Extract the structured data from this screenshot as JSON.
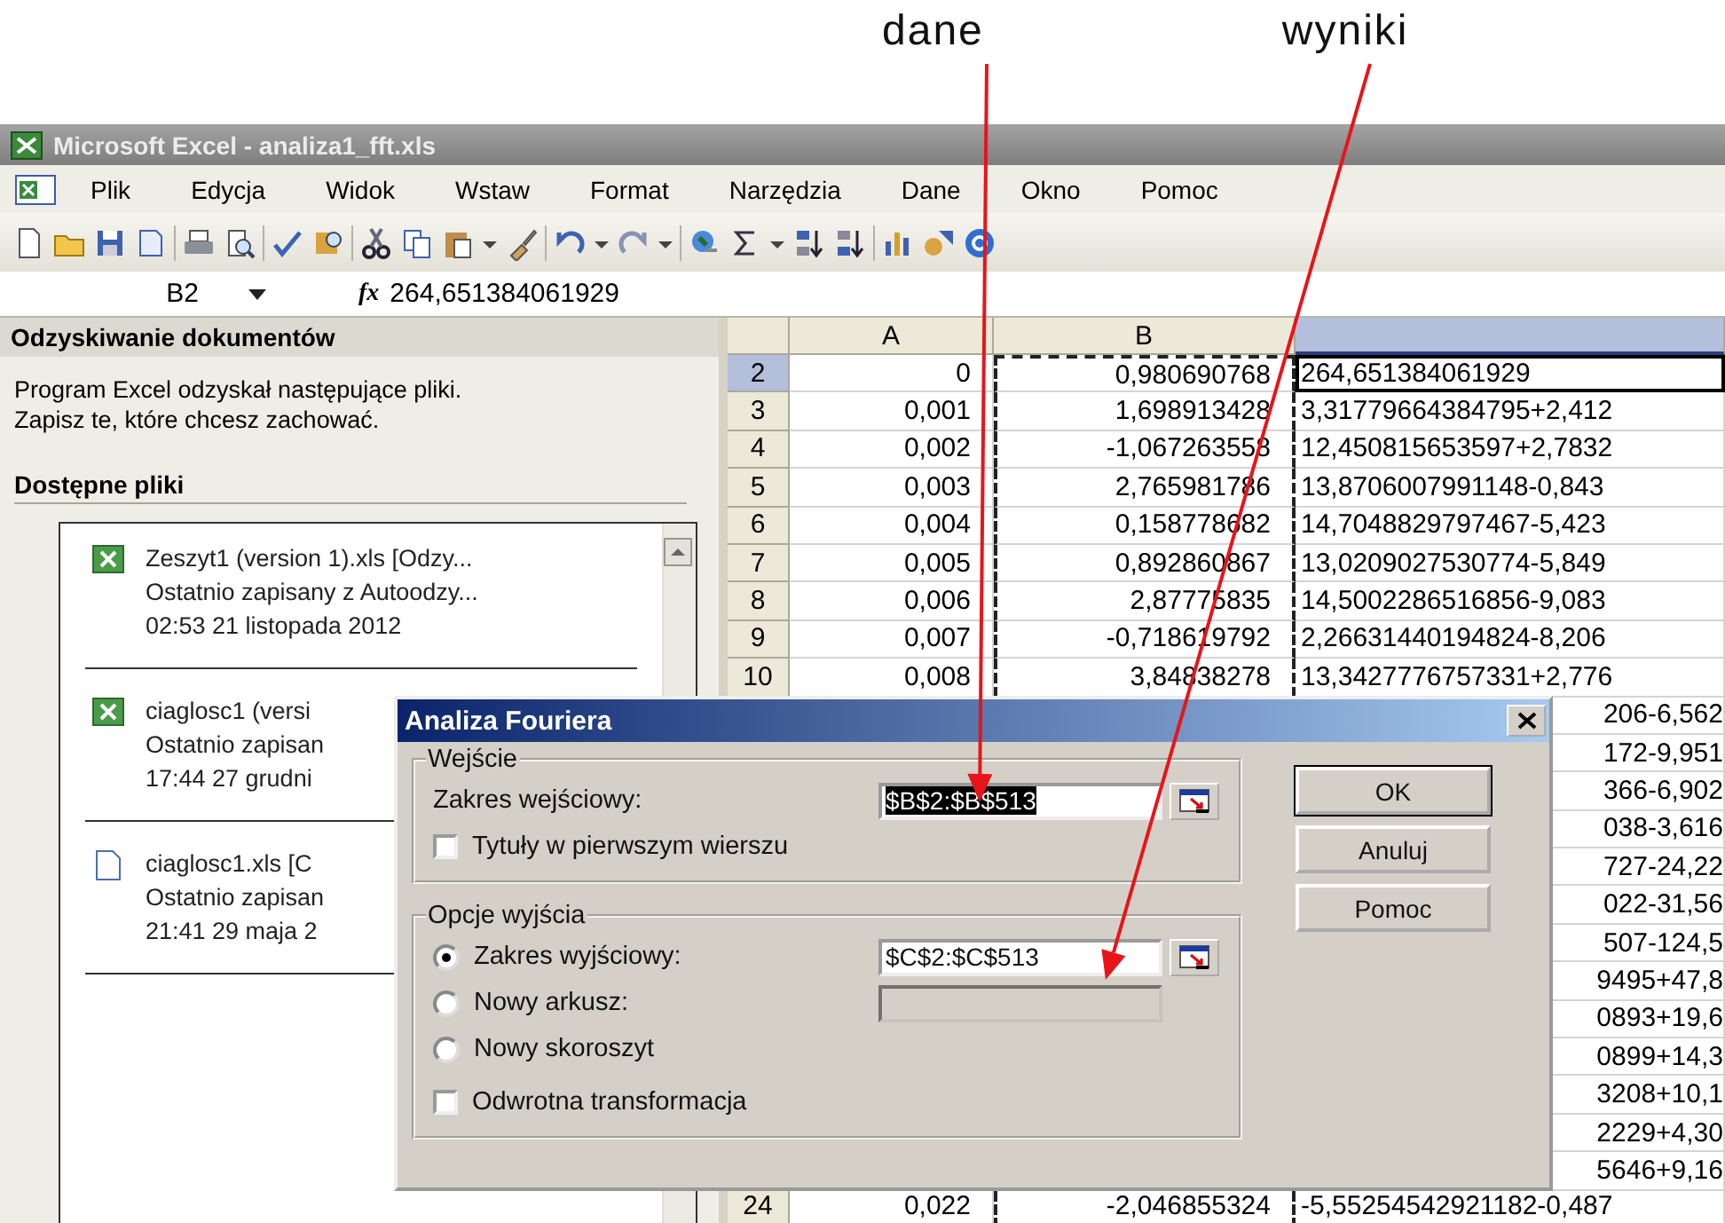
{
  "annotations": [
    {
      "label": "dane"
    },
    {
      "label": "wyniki"
    }
  ],
  "window": {
    "title": "Microsoft Excel - analiza1_fft.xls"
  },
  "menu": [
    "Plik",
    "Edycja",
    "Widok",
    "Wstaw",
    "Format",
    "Narzędzia",
    "Dane",
    "Okno",
    "Pomoc"
  ],
  "formula_bar": {
    "cell": "B2",
    "function_label": "fx",
    "value": "264,651384061929"
  },
  "task_pane": {
    "title": "Odzyskiwanie dokumentów",
    "message_lines": [
      "Program Excel odzyskał następujące pliki.",
      "Zapisz te, które chcesz zachować."
    ],
    "section": "Dostępne pliki",
    "files": [
      {
        "kind": "excel",
        "name": "Zeszyt1 (version 1).xls  [Odzy...",
        "saved": "Ostatnio zapisany z Autoodzy...",
        "time": "02:53 21 listopada 2012"
      },
      {
        "kind": "excel",
        "name": "ciaglosc1 (versi",
        "saved": "Ostatnio zapisan",
        "time": "17:44 27 grudni"
      },
      {
        "kind": "document",
        "name": "ciaglosc1.xls  [C",
        "saved": "Ostatnio zapisan",
        "time": "21:41 29 maja 2"
      }
    ]
  },
  "sheet": {
    "columns": [
      {
        "label": "A",
        "selected": false,
        "marquee": false
      },
      {
        "label": "B",
        "selected": false,
        "marquee": true
      },
      {
        "selected": true,
        "marquee": false
      }
    ],
    "rows": [
      {
        "number": "2",
        "selected": true,
        "a": "0",
        "b": "0,980690768",
        "c": "264,651384061929"
      },
      {
        "number": "3",
        "selected": false,
        "a": "0,001",
        "b": "1,698913428",
        "c": "3,31779664384795+2,412"
      },
      {
        "number": "4",
        "selected": false,
        "a": "0,002",
        "b": "-1,067263558",
        "c": "12,450815653597+2,7832"
      },
      {
        "number": "5",
        "selected": false,
        "a": "0,003",
        "b": "2,765981786",
        "c": "13,8706007991148-0,843"
      },
      {
        "number": "6",
        "selected": false,
        "a": "0,004",
        "b": "0,158778682",
        "c": "14,7048829797467-5,423"
      },
      {
        "number": "7",
        "selected": false,
        "a": "0,005",
        "b": "0,892860867",
        "c": "13,0209027530774-5,849"
      },
      {
        "number": "8",
        "selected": false,
        "a": "0,006",
        "b": "2,87775835",
        "c": "14,5002286516856-9,083"
      },
      {
        "number": "9",
        "selected": false,
        "a": "0,007",
        "b": "-0,718619792",
        "c": "2,26631440194824-8,206"
      },
      {
        "number": "10",
        "selected": false,
        "a": "0,008",
        "b": "3,84838278",
        "c": "13,3427776757331+2,776"
      },
      {
        "c": "206-6,562"
      },
      {
        "c": "172-9,951"
      },
      {
        "c": "366-6,902"
      },
      {
        "c": "038-3,616"
      },
      {
        "c": "727-24,22"
      },
      {
        "c": "022-31,56"
      },
      {
        "c": "507-124,5"
      },
      {
        "c": "9495+47,8"
      },
      {
        "c": "0893+19,6"
      },
      {
        "c": "0899+14,3"
      },
      {
        "c": "3208+10,1"
      },
      {
        "c": "2229+4,30"
      },
      {
        "c": "5646+9,16"
      },
      {
        "number": "24",
        "selected": false,
        "a": "0,022",
        "b": "-2,046855324",
        "c": "-5,55254542921182-0,487"
      }
    ]
  },
  "dialog": {
    "title": "Analiza Fouriera",
    "input_group": {
      "title": "Wejście",
      "range_label": "Zakres wejściowy:",
      "range_value": "$B$2:$B$513",
      "highlighted": true,
      "checkbox": {
        "label": "Tytuły w pierwszym wierszu",
        "checked": false
      }
    },
    "output_group": {
      "title": "Opcje wyjścia",
      "options": [
        {
          "label": "Zakres wyjściowy:",
          "selected": true,
          "field": {
            "value": "$C$2:$C$513",
            "disabled": false
          }
        },
        {
          "label": "Nowy arkusz:",
          "selected": false,
          "field": {
            "disabled": true
          }
        },
        {
          "label": "Nowy skoroszyt",
          "selected": false
        }
      ],
      "checkbox": {
        "label": "Odwrotna transformacja",
        "checked": false
      }
    },
    "buttons": [
      {
        "label": "OK",
        "default": true
      },
      {
        "label": "Anuluj",
        "default": false
      },
      {
        "label": "Pomoc",
        "default": false
      }
    ]
  }
}
